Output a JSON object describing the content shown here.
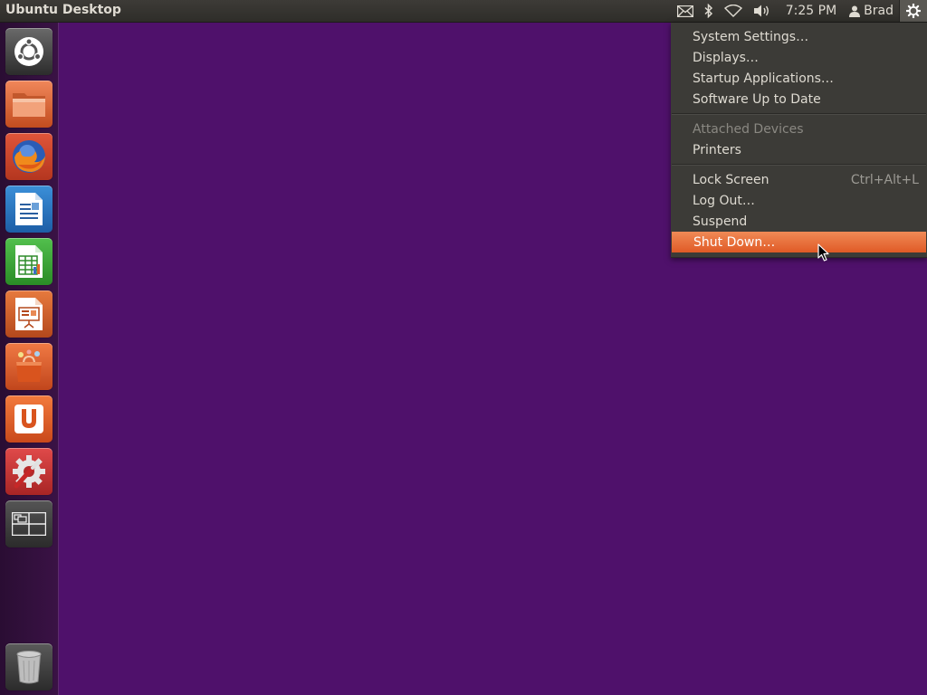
{
  "panel": {
    "title": "Ubuntu Desktop",
    "clock": "7:25 PM",
    "user": "Brad",
    "icons": [
      "mail-icon",
      "bluetooth-icon",
      "wifi-icon",
      "volume-icon",
      "user-icon",
      "gear-icon"
    ]
  },
  "launcher": {
    "items": [
      {
        "name": "Dash Home",
        "icon": "ubuntu-logo-icon"
      },
      {
        "name": "Files",
        "icon": "folder-icon"
      },
      {
        "name": "Firefox Web Browser",
        "icon": "firefox-icon"
      },
      {
        "name": "LibreOffice Writer",
        "icon": "writer-icon"
      },
      {
        "name": "LibreOffice Calc",
        "icon": "calc-icon"
      },
      {
        "name": "LibreOffice Impress",
        "icon": "impress-icon"
      },
      {
        "name": "Ubuntu Software Center",
        "icon": "shopping-bag-icon"
      },
      {
        "name": "Ubuntu One",
        "icon": "ubuntu-one-icon"
      },
      {
        "name": "System Settings",
        "icon": "settings-icon"
      },
      {
        "name": "Workspace Switcher",
        "icon": "workspaces-icon"
      },
      {
        "name": "Trash",
        "icon": "trash-icon"
      }
    ]
  },
  "menu": {
    "items": [
      {
        "label": "System Settings…"
      },
      {
        "label": "Displays…"
      },
      {
        "label": "Startup Applications…"
      },
      {
        "label": "Software Up to Date"
      },
      {
        "label": "Attached Devices"
      },
      {
        "label": "Printers"
      },
      {
        "label": "Lock Screen",
        "accel": "Ctrl+Alt+L"
      },
      {
        "label": "Log Out…"
      },
      {
        "label": "Suspend"
      },
      {
        "label": "Shut Down…"
      }
    ]
  },
  "colors": {
    "desktop": "#4f116b",
    "panel": "#3c3b37",
    "accent": "#e8642e"
  }
}
